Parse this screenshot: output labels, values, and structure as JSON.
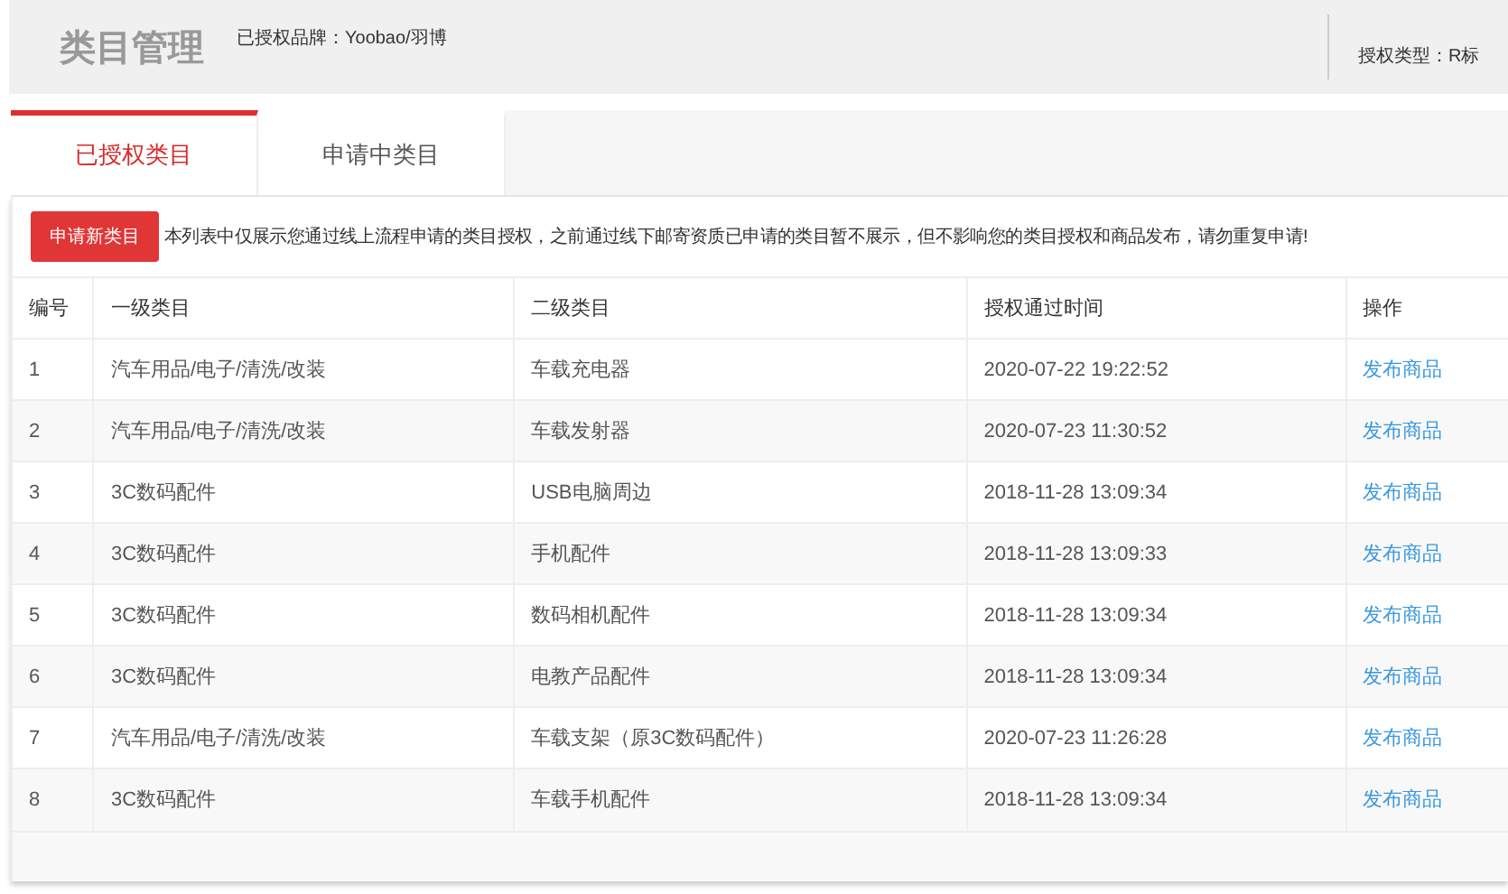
{
  "header": {
    "title": "类目管理",
    "brand": "已授权品牌：Yoobao/羽博",
    "auth_type": "授权类型：R标"
  },
  "tabs": [
    {
      "label": "已授权类目",
      "selected": true
    },
    {
      "label": "申请中类目",
      "selected": false
    }
  ],
  "apply_button": "申请新类目",
  "notice": "本列表中仅展示您通过线上流程申请的类目授权，之前通过线下邮寄资质已申请的类目暂不展示，但不影响您的类目授权和商品发布，请勿重复申请!",
  "table": {
    "columns": [
      "编号",
      "一级类目",
      "二级类目",
      "授权通过时间",
      "操作"
    ],
    "rows": [
      {
        "cells": [
          "1",
          "汽车用品/电子/清洗/改装",
          "车载充电器",
          "2020-07-22 19:22:52"
        ],
        "action": "发布商品"
      },
      {
        "cells": [
          "2",
          "汽车用品/电子/清洗/改装",
          "车载发射器",
          "2020-07-23 11:30:52"
        ],
        "action": "发布商品"
      },
      {
        "cells": [
          "3",
          "3C数码配件",
          "USB电脑周边",
          "2018-11-28 13:09:34"
        ],
        "action": "发布商品"
      },
      {
        "cells": [
          "4",
          "3C数码配件",
          "手机配件",
          "2018-11-28 13:09:33"
        ],
        "action": "发布商品"
      },
      {
        "cells": [
          "5",
          "3C数码配件",
          "数码相机配件",
          "2018-11-28 13:09:34"
        ],
        "action": "发布商品"
      },
      {
        "cells": [
          "6",
          "3C数码配件",
          "电教产品配件",
          "2018-11-28 13:09:34"
        ],
        "action": "发布商品"
      },
      {
        "cells": [
          "7",
          "汽车用品/电子/清洗/改装",
          "车载支架（原3C数码配件）",
          "2020-07-23 11:26:28"
        ],
        "action": "发布商品"
      },
      {
        "cells": [
          "8",
          "3C数码配件",
          "车载手机配件",
          "2018-11-28 13:09:34"
        ],
        "action": "发布商品"
      }
    ]
  }
}
